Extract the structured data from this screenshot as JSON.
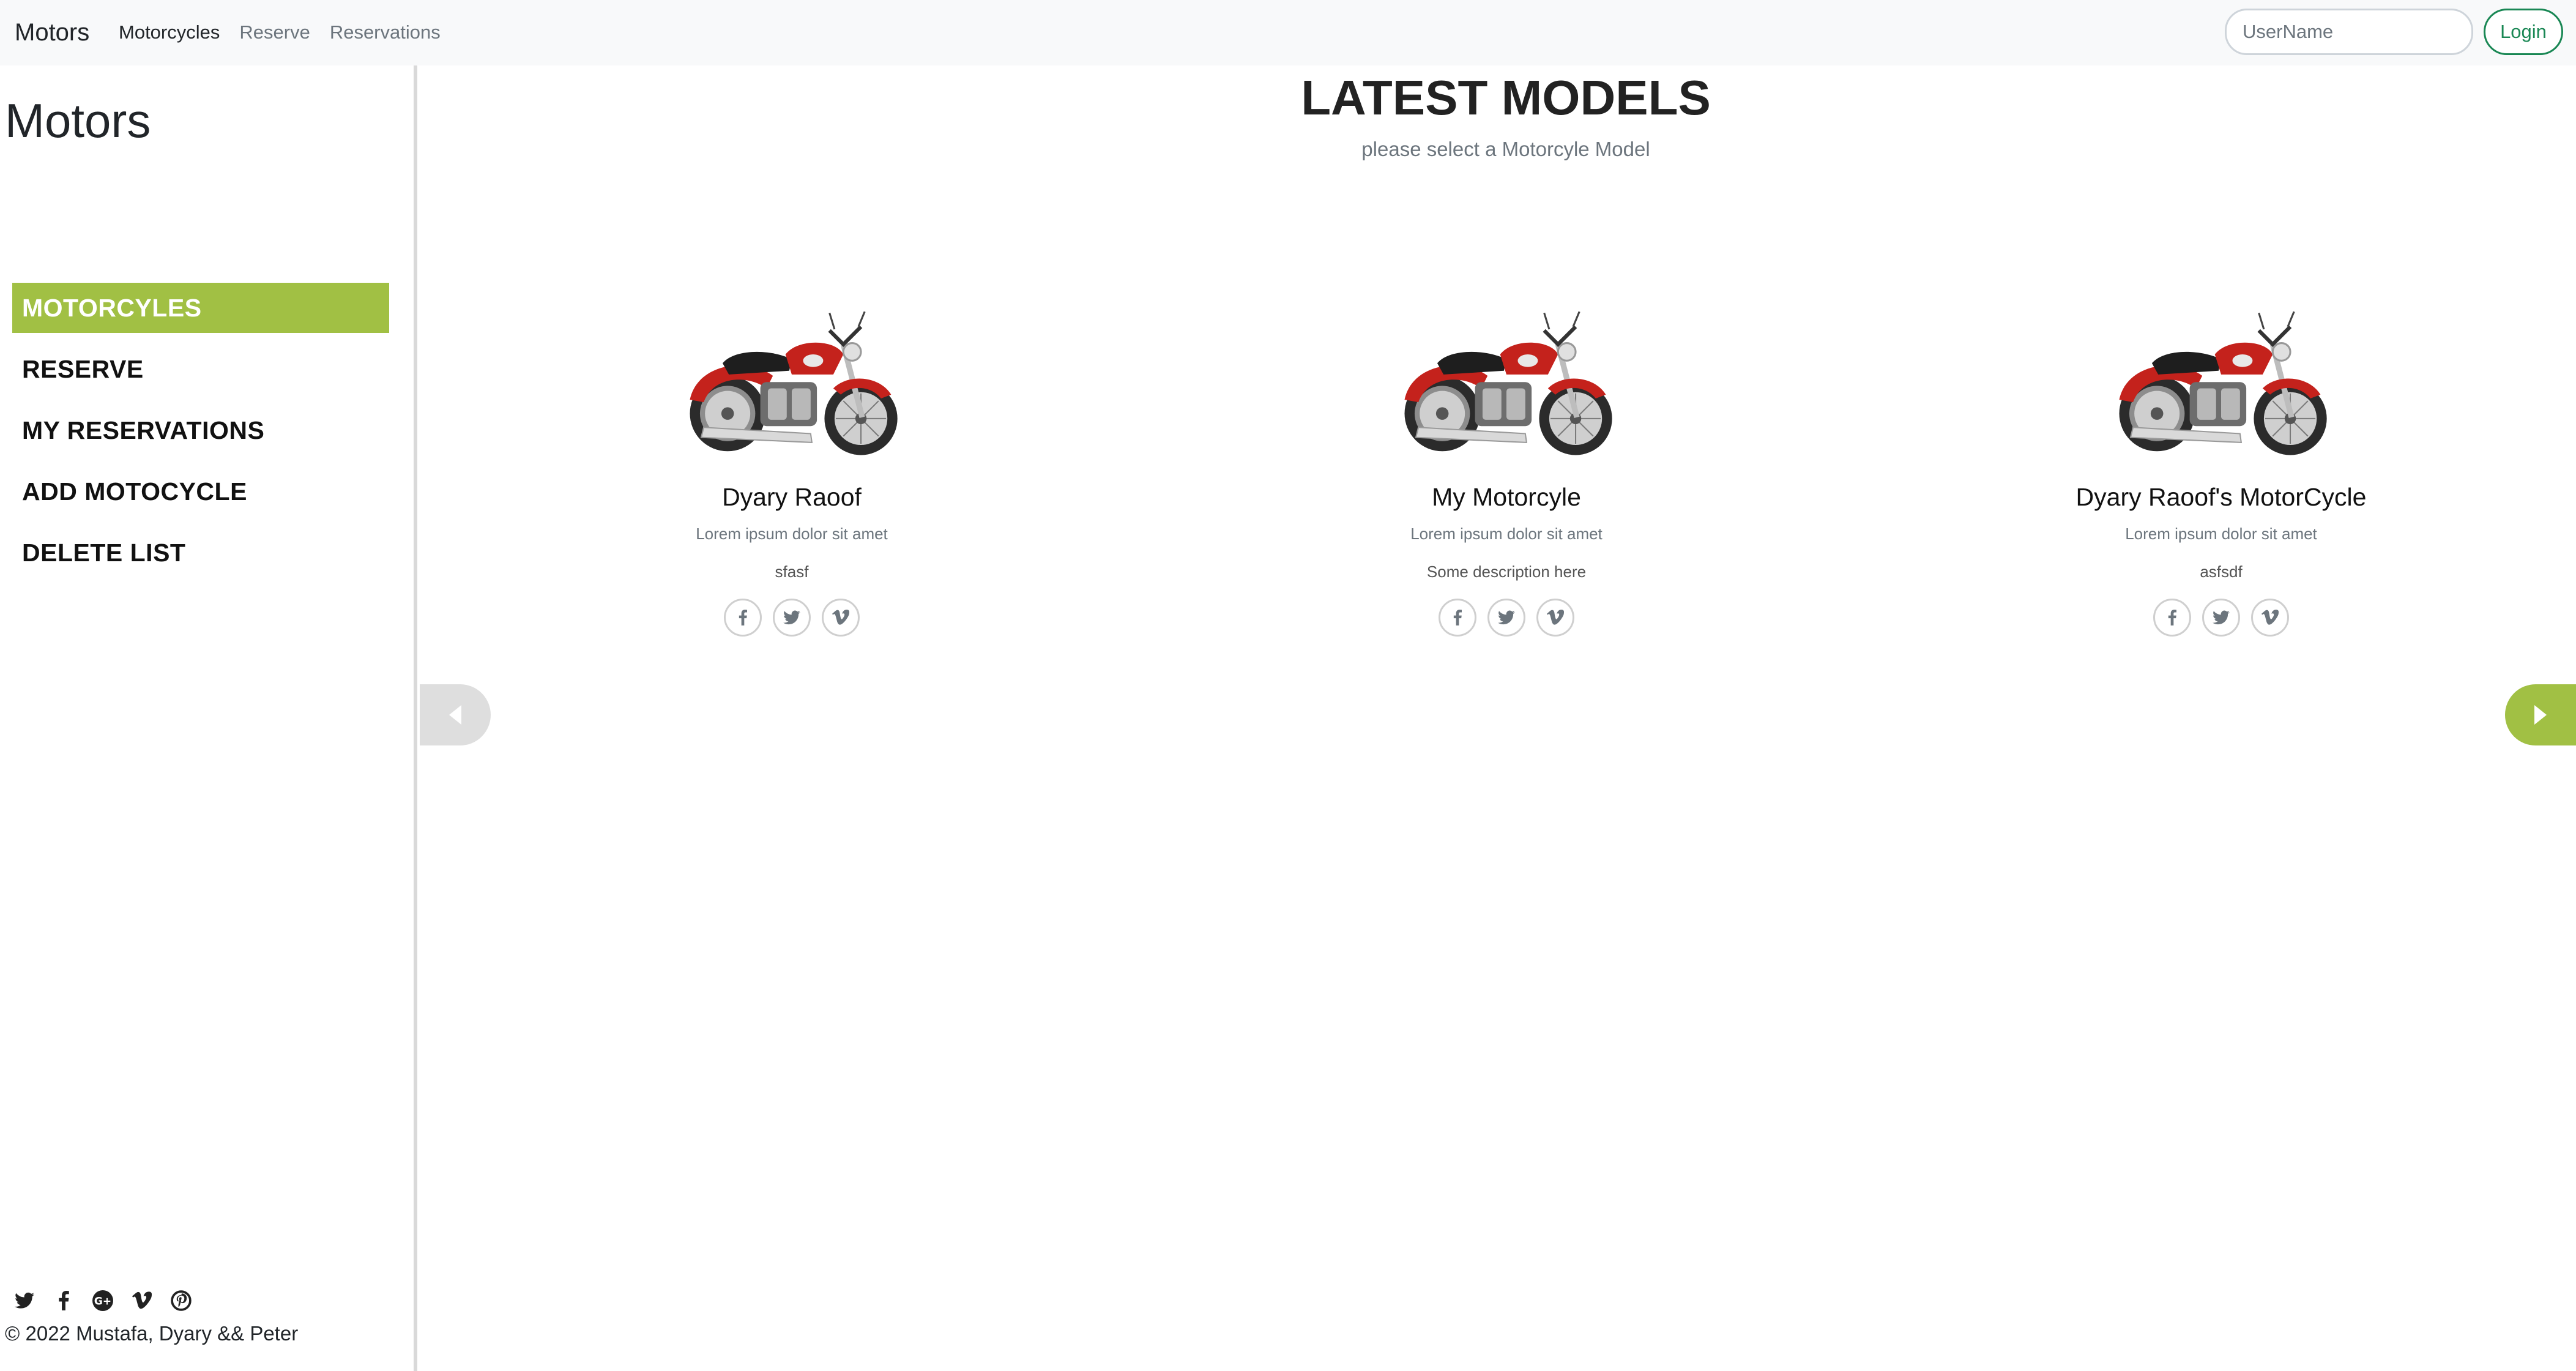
{
  "navbar": {
    "brand": "Motors",
    "links": [
      {
        "label": "Motorcycles",
        "active": true
      },
      {
        "label": "Reserve",
        "active": false
      },
      {
        "label": "Reservations",
        "active": false
      }
    ],
    "username_placeholder": "UserName",
    "login_label": "Login"
  },
  "sidebar": {
    "title": "Motors",
    "menu": [
      {
        "label": "MOTORCYLES",
        "active": true
      },
      {
        "label": "RESERVE",
        "active": false
      },
      {
        "label": "MY RESERVATIONS",
        "active": false
      },
      {
        "label": "ADD MOTOCYCLE",
        "active": false
      },
      {
        "label": "DELETE LIST",
        "active": false
      }
    ],
    "social_icons": [
      "twitter-icon",
      "facebook-icon",
      "google-plus-icon",
      "vimeo-icon",
      "pinterest-icon"
    ],
    "copyright": "© 2022 Mustafa, Dyary && Peter"
  },
  "main": {
    "title": "LATEST MODELS",
    "subtitle": "please select a Motorcyle Model",
    "cards": [
      {
        "name": "Dyary Raoof",
        "lorem": "Lorem ipsum dolor sit amet",
        "description": "sfasf"
      },
      {
        "name": "My Motorcyle",
        "lorem": "Lorem ipsum dolor sit amet",
        "description": "Some description here"
      },
      {
        "name": "Dyary Raoof's MotorCycle",
        "lorem": "Lorem ipsum dolor sit amet",
        "description": "asfsdf"
      }
    ],
    "card_icons": [
      "facebook-icon",
      "twitter-icon",
      "vimeo-icon"
    ]
  },
  "colors": {
    "accent": "#a1c044",
    "login": "#198754",
    "navbar_bg": "#f8f9fa"
  }
}
